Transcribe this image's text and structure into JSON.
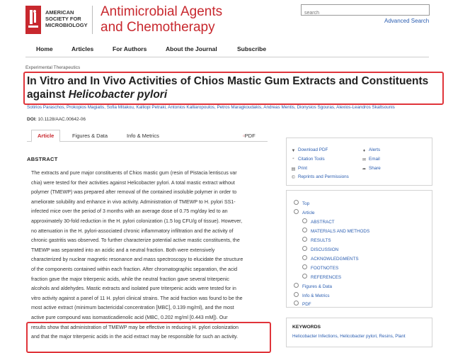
{
  "header": {
    "society_name": "AMERICAN SOCIETY FOR MICROBIOLOGY",
    "journal_line1": "Antimicrobial Agents",
    "journal_line2": "and Chemotherapy",
    "search_placeholder": "search",
    "advanced_search": "Advanced Search",
    "brand_color": "#c8282e"
  },
  "nav": [
    "Home",
    "Articles",
    "For Authors",
    "About the Journal",
    "Subscribe"
  ],
  "article": {
    "breadcrumb": "Experimental Therapeutics",
    "title_main": "In Vitro and In Vivo Activities of Chios Mastic Gum Extracts and Constituents against ",
    "title_italic": "Helicobacter pylori",
    "authors": "Sotirios Paraschos, Prokopios Magiatis, Sofia Mitakou, Kalliopi Petraki, Antonios Kalliaropoulos, Petros Maragkoudakis, Andreas Mentis, Dionysios Sgouras, Alexios-Leandros Skaltsounis",
    "doi_label": "DOI:",
    "doi_value": "10.1128/AAC.00642-06"
  },
  "tabs": [
    "Article",
    "Figures & Data",
    "Info & Metrics",
    "PDF"
  ],
  "abstract": {
    "heading": "ABSTRACT",
    "lines": [
      "The extracts and pure major constituents of Chios mastic gum (resin of Pistacia lentiscus var",
      "chia) were tested for their activities against Helicobacter pylori. A total mastic extract without",
      "polymer (TMEWP) was prepared after removal of the contained insoluble polymer in order to",
      "ameliorate solubility and enhance in vivo activity. Administration of TMEWP to H. pylori SS1-",
      "infected mice over the period of 3 months with an average dose of 0.75 mg/day led to an",
      "approximately 30-fold reduction in the H. pylori colonization (1.5 log CFU/g of tissue). However,",
      "no attenuation in the H. pylori-associated chronic inflammatory infiltration and the activity of",
      "chronic gastritis was observed. To further characterize potential active mastic constituents, the",
      "TMEWP was separated into an acidic and a neutral fraction. Both were extensively",
      "characterized by nuclear magnetic resonance and mass spectroscopy to elucidate the structure",
      "of the components contained within each fraction. After chromatographic separation, the acid",
      "fraction gave the major triterpenic acids, while the neutral fraction gave several triterpenic",
      "alcohols and aldehydes. Mastic extracts and isolated pure triterpenic acids were tested for in",
      "vitro activity against a panel of 11 H. pylori clinical strains. The acid fraction was found to be the",
      "most active extract (minimum bactericidal concentration [MBC], 0.139 mg/ml), and the most",
      "active pure compound was isomasticadienolic acid (MBC, 0.202 mg/ml [0.443 mM]). Our",
      "results show that administration of TMEWP may be effective in reducing H. pylori colonization",
      "and that the major triterpenic acids in the acid extract may be responsible for such an activity."
    ]
  },
  "tools": {
    "download_pdf": "Download PDF",
    "alerts": "Alerts",
    "citation_tools": "Citation Tools",
    "email": "Email",
    "print": "Print",
    "share": "Share",
    "reprints": "Reprints and Permissions"
  },
  "toc": [
    "Top",
    "Article",
    "ABSTRACT",
    "MATERIALS AND METHODS",
    "RESULTS",
    "DISCUSSION",
    "ACKNOWLEDGMENTS",
    "FOOTNOTES",
    "REFERENCES",
    "Figures & Data",
    "Info & Metrics",
    "PDF"
  ],
  "keywords": {
    "heading": "KEYWORDS",
    "text": "Helicobacter Infections, Helicobacter pylori, Resins, Plant"
  }
}
